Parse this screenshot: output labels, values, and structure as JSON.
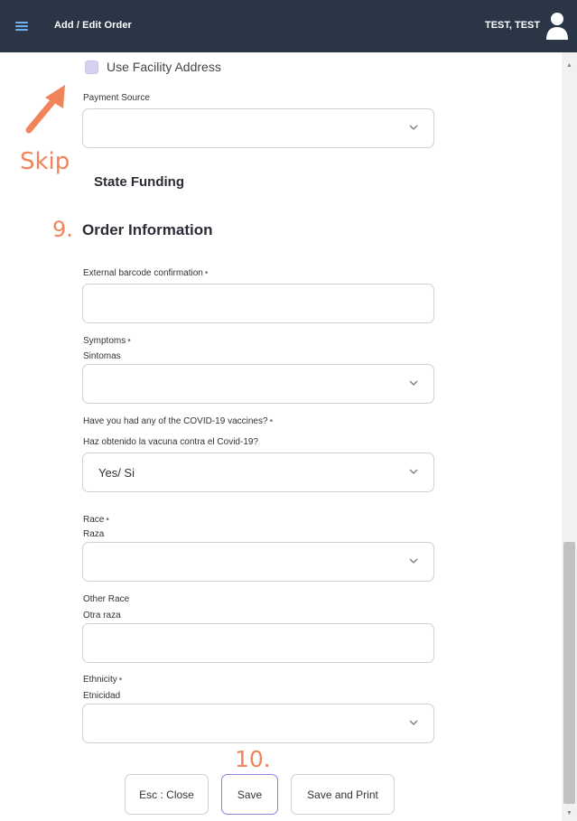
{
  "header": {
    "title": "Add / Edit Order",
    "user": "TEST, TEST"
  },
  "facility": {
    "checkbox_label": "Use Facility Address"
  },
  "payment": {
    "label": "Payment Source",
    "value": ""
  },
  "annotations": {
    "skip": "Skip",
    "step9": "9.",
    "step10": "10."
  },
  "state_funding": {
    "title": "State Funding"
  },
  "order_info": {
    "title": "Order Information",
    "fields": {
      "barcode": {
        "label": "External barcode confirmation",
        "req": "•",
        "value": ""
      },
      "symptoms": {
        "label": "Symptoms",
        "req": "•",
        "sub": "Sintomas",
        "value": ""
      },
      "vaccine": {
        "label": "Have you had any of the COVID-19 vaccines?",
        "req": "•",
        "sub": "Haz obtenido la vacuna contra el Covid-19?",
        "value": "Yes/ Si"
      },
      "race": {
        "label": "Race",
        "req": "•",
        "sub": "Raza",
        "value": ""
      },
      "other_race": {
        "label": "Other Race",
        "sub": "Otra raza",
        "value": ""
      },
      "ethnicity": {
        "label": "Ethnicity",
        "req": "•",
        "sub": "Etnicidad",
        "value": ""
      }
    }
  },
  "buttons": {
    "close": "Esc : Close",
    "save": "Save",
    "save_print": "Save and Print"
  }
}
